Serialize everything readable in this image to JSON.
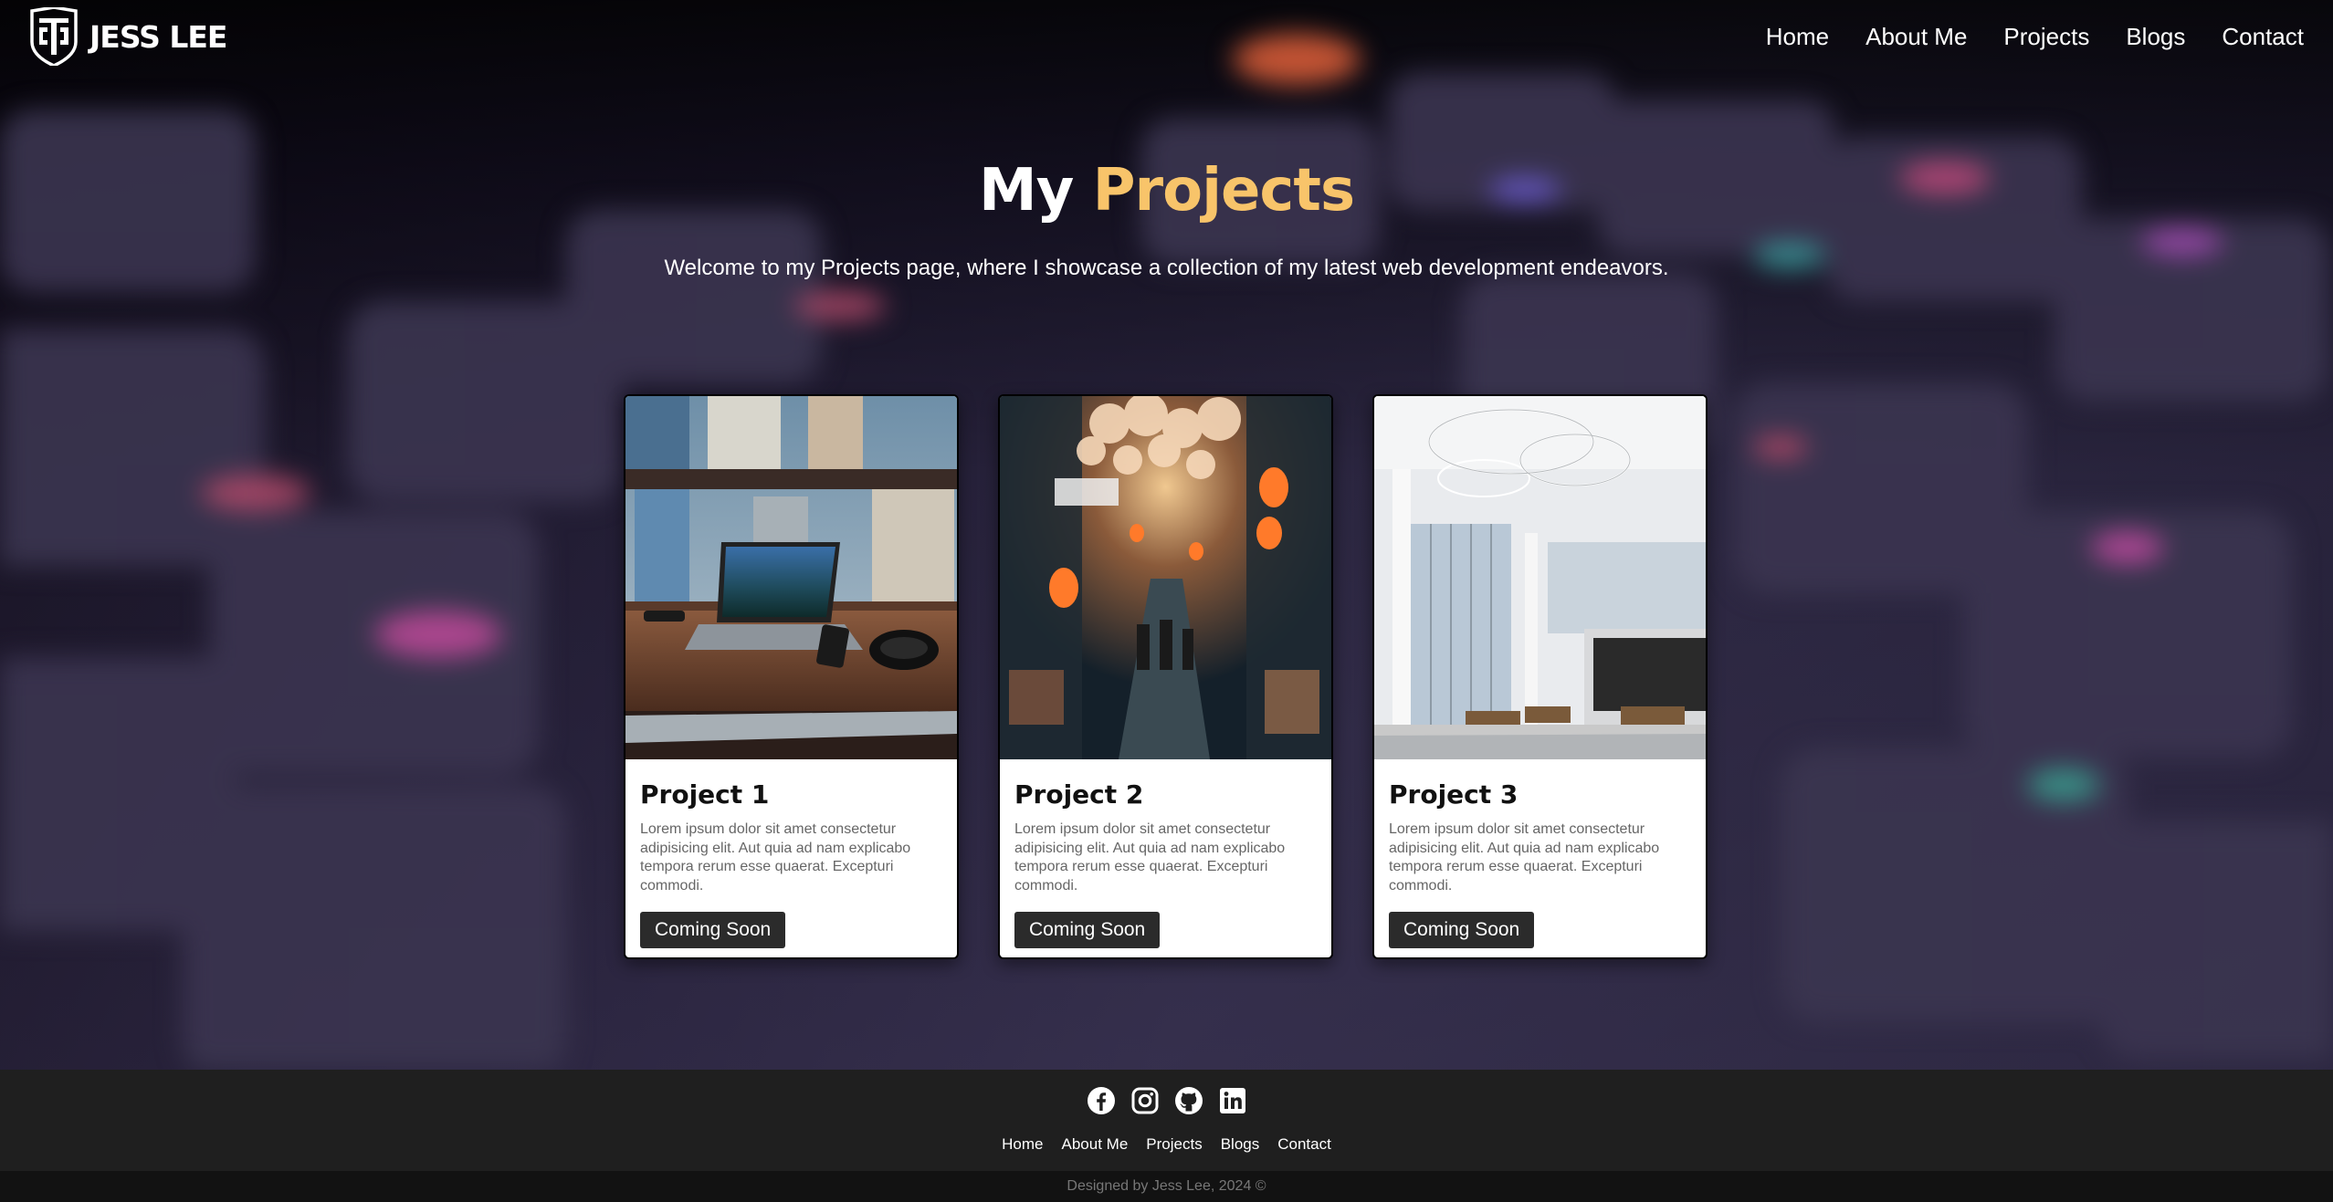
{
  "header": {
    "brand": "JESS LEE",
    "logo_icon": "shield-monogram-icon",
    "nav": [
      {
        "label": "Home"
      },
      {
        "label": "About Me"
      },
      {
        "label": "Projects"
      },
      {
        "label": "Blogs"
      },
      {
        "label": "Contact"
      }
    ]
  },
  "hero": {
    "title_part1": "My",
    "title_part2": "Projects",
    "subtitle": "Welcome to my Projects page, where I showcase a collection of my latest web development endeavors.",
    "accent_color": "#f8c46a"
  },
  "projects": [
    {
      "title": "Project 1",
      "image": "laptop-workspace-photo",
      "description": "Lorem ipsum dolor sit amet consectetur adipisicing elit. Aut quia ad nam explicabo tempora rerum esse quaerat. Excepturi commodi.",
      "button": "Coming Soon"
    },
    {
      "title": "Project 2",
      "image": "night-alley-lanterns-photo",
      "description": "Lorem ipsum dolor sit amet consectetur adipisicing elit. Aut quia ad nam explicabo tempora rerum esse quaerat. Excepturi commodi.",
      "button": "Coming Soon"
    },
    {
      "title": "Project 3",
      "image": "modern-interior-photo",
      "description": "Lorem ipsum dolor sit amet consectetur adipisicing elit. Aut quia ad nam explicabo tempora rerum esse quaerat. Excepturi commodi.",
      "button": "Coming Soon"
    }
  ],
  "footer": {
    "social": [
      "facebook-icon",
      "instagram-icon",
      "github-icon",
      "linkedin-icon"
    ],
    "nav": [
      {
        "label": "Home"
      },
      {
        "label": "About Me"
      },
      {
        "label": "Projects"
      },
      {
        "label": "Blogs"
      },
      {
        "label": "Contact"
      }
    ],
    "copyright": "Designed by Jess Lee, 2024 ©"
  }
}
